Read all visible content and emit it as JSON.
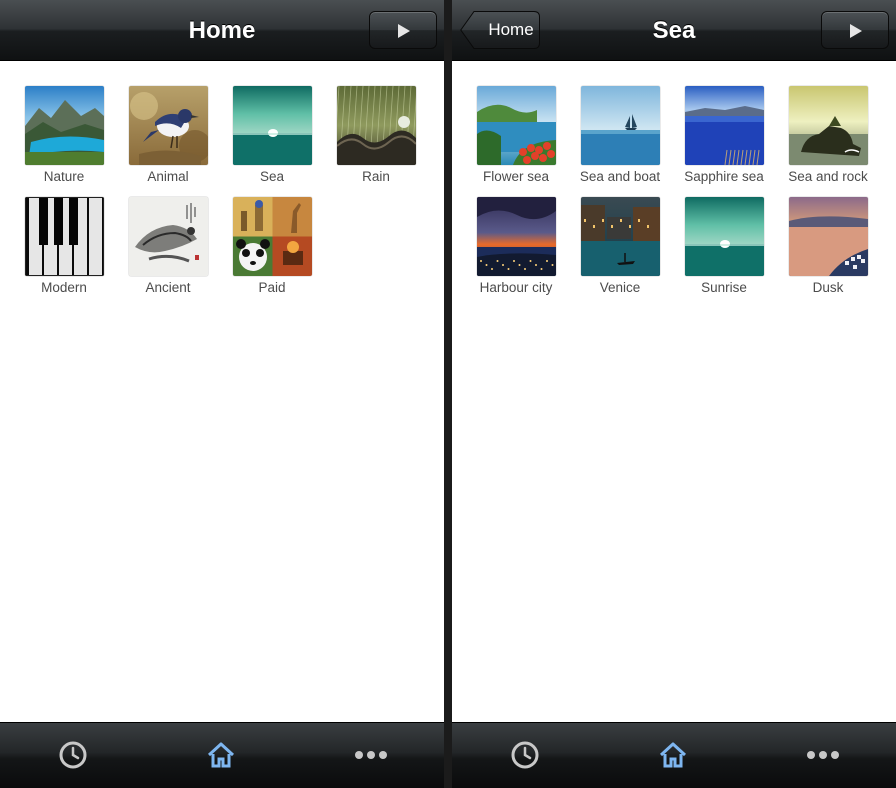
{
  "screens": [
    {
      "title": "Home",
      "back": null,
      "items": [
        {
          "label": "Nature",
          "thumb": "nature"
        },
        {
          "label": "Animal",
          "thumb": "animal"
        },
        {
          "label": "Sea",
          "thumb": "sea"
        },
        {
          "label": "Rain",
          "thumb": "rain"
        },
        {
          "label": "Modern",
          "thumb": "piano"
        },
        {
          "label": "Ancient",
          "thumb": "ink"
        },
        {
          "label": "Paid",
          "thumb": "collage"
        }
      ],
      "tabs": [
        {
          "icon": "clock-icon",
          "active": false
        },
        {
          "icon": "home-icon",
          "active": true
        },
        {
          "icon": "more-icon",
          "active": false
        }
      ]
    },
    {
      "title": "Sea",
      "back": "Home",
      "items": [
        {
          "label": "Flower sea",
          "thumb": "flowersea"
        },
        {
          "label": "Sea and boat",
          "thumb": "boat"
        },
        {
          "label": "Sapphire sea",
          "thumb": "sapphire"
        },
        {
          "label": "Sea and rock",
          "thumb": "rock"
        },
        {
          "label": "Harbour city",
          "thumb": "harbour"
        },
        {
          "label": "Venice",
          "thumb": "venice"
        },
        {
          "label": "Sunrise",
          "thumb": "sea"
        },
        {
          "label": "Dusk",
          "thumb": "dusk"
        }
      ],
      "tabs": [
        {
          "icon": "clock-icon",
          "active": false
        },
        {
          "icon": "home-icon",
          "active": true
        },
        {
          "icon": "more-icon",
          "active": false
        }
      ]
    }
  ],
  "colors": {
    "active_tab": "#7eb6f0",
    "inactive_tab": "#c8c8c8",
    "caption": "#4c4c4c"
  }
}
